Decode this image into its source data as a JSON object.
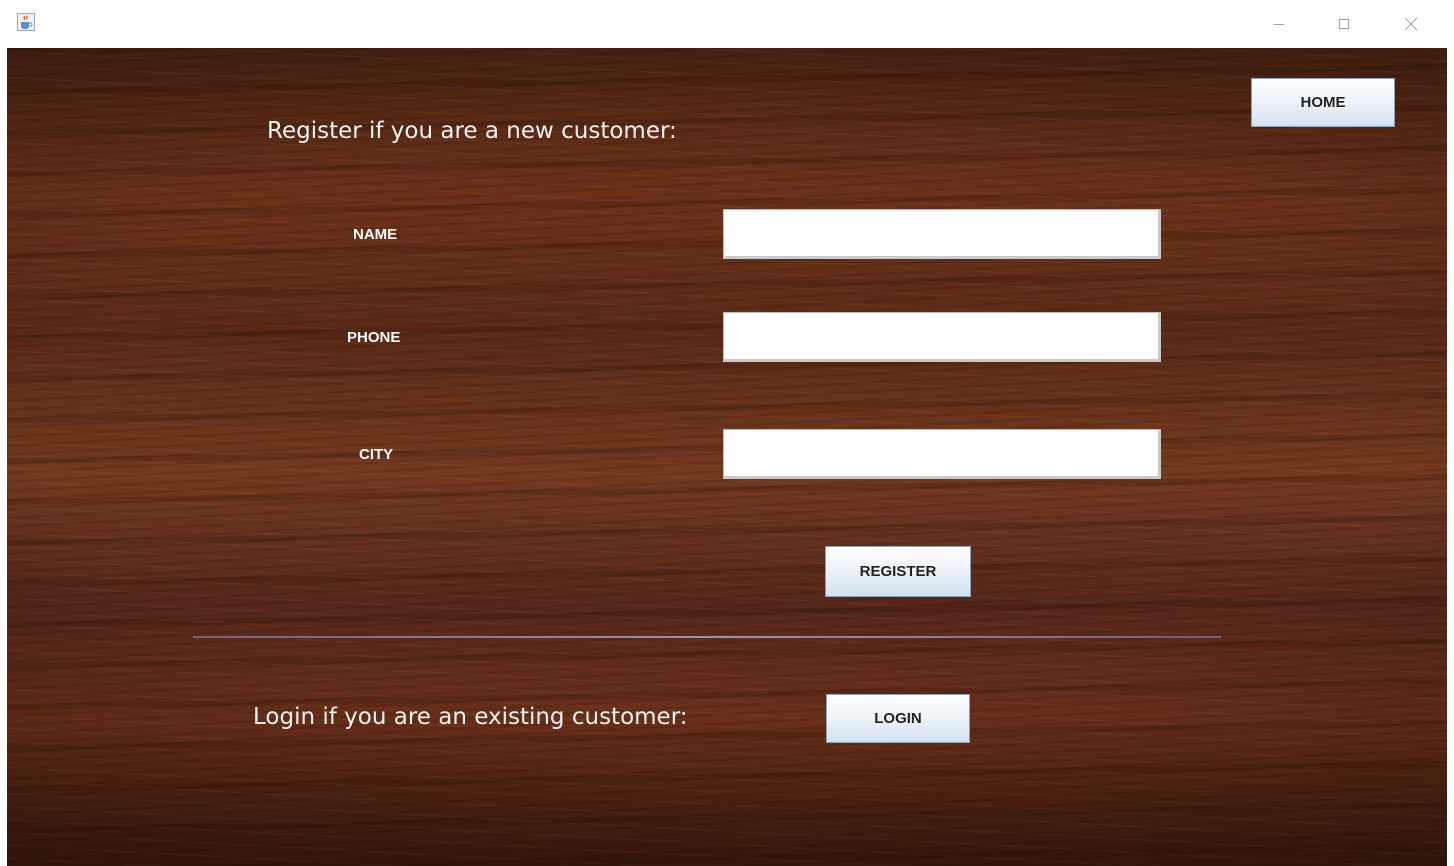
{
  "titlebar": {
    "icon": "java-cup-icon",
    "controls": {
      "minimize": "minimize-icon",
      "maximize": "maximize-icon",
      "close": "close-icon"
    }
  },
  "register": {
    "heading": "Register if you are a new customer:",
    "fields": {
      "name": {
        "label": "NAME",
        "value": ""
      },
      "phone": {
        "label": "PHONE",
        "value": ""
      },
      "city": {
        "label": "CITY",
        "value": ""
      }
    },
    "button_label": "REGISTER"
  },
  "login": {
    "heading": "Login if you are an existing customer:",
    "button_label": "LOGIN"
  },
  "home_button_label": "HOME",
  "colors": {
    "background_wood": "#6b3219",
    "text": "#ffffff",
    "button_gradient_bottom": "#d3e2f0"
  }
}
